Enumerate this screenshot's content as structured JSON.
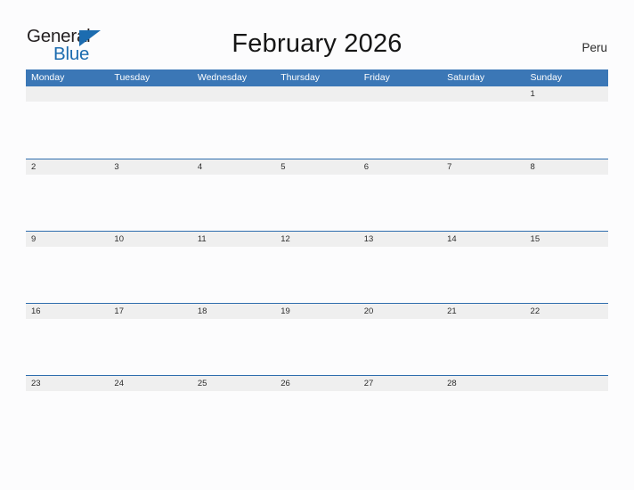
{
  "brand": {
    "name_part1": "General",
    "name_part2": "Blue",
    "triangle_color": "#1C6CB0",
    "text_color": "#231F20"
  },
  "header": {
    "title": "February 2026",
    "region": "Peru"
  },
  "theme": {
    "header_blue": "#3B77B6",
    "row_divider_blue": "#2E6DAD",
    "date_band_gray": "#EFEFEF",
    "page_background": "#FCFCFD"
  },
  "calendar": {
    "month": "February",
    "year": "2026",
    "weekday_headers": [
      "Monday",
      "Tuesday",
      "Wednesday",
      "Thursday",
      "Friday",
      "Saturday",
      "Sunday"
    ],
    "weeks": [
      {
        "days": [
          {
            "number": ""
          },
          {
            "number": ""
          },
          {
            "number": ""
          },
          {
            "number": ""
          },
          {
            "number": ""
          },
          {
            "number": ""
          },
          {
            "number": "1"
          }
        ]
      },
      {
        "days": [
          {
            "number": "2"
          },
          {
            "number": "3"
          },
          {
            "number": "4"
          },
          {
            "number": "5"
          },
          {
            "number": "6"
          },
          {
            "number": "7"
          },
          {
            "number": "8"
          }
        ]
      },
      {
        "days": [
          {
            "number": "9"
          },
          {
            "number": "10"
          },
          {
            "number": "11"
          },
          {
            "number": "12"
          },
          {
            "number": "13"
          },
          {
            "number": "14"
          },
          {
            "number": "15"
          }
        ]
      },
      {
        "days": [
          {
            "number": "16"
          },
          {
            "number": "17"
          },
          {
            "number": "18"
          },
          {
            "number": "19"
          },
          {
            "number": "20"
          },
          {
            "number": "21"
          },
          {
            "number": "22"
          }
        ]
      },
      {
        "days": [
          {
            "number": "23"
          },
          {
            "number": "24"
          },
          {
            "number": "25"
          },
          {
            "number": "26"
          },
          {
            "number": "27"
          },
          {
            "number": "28"
          },
          {
            "number": ""
          }
        ]
      }
    ]
  }
}
